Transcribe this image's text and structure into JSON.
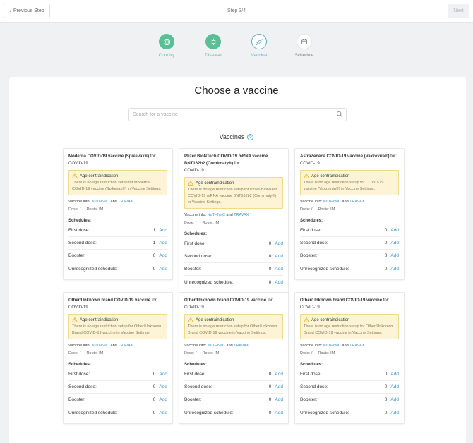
{
  "topbar": {
    "prev_label": "Previous Step",
    "step_label": "Step 3/4",
    "next_label": "Next"
  },
  "stepper": [
    {
      "label": "Country",
      "state": "done",
      "icon": "globe-icon"
    },
    {
      "label": "Disease",
      "state": "done",
      "icon": "virus-icon"
    },
    {
      "label": "Vaccine",
      "state": "active",
      "icon": "syringe-icon"
    },
    {
      "label": "Schedule",
      "state": "pending",
      "icon": "calendar-icon"
    }
  ],
  "main": {
    "title": "Choose a vaccine",
    "search_placeholder": "Search for a vaccine",
    "vaccines_label": "Vaccines",
    "vaccines_count": "6"
  },
  "colors": {
    "green": "#5bbf95",
    "blue": "#5ba9d6",
    "link": "#3a97d4",
    "warning_bg": "#fdf4d6"
  },
  "cards": [
    {
      "name": "Moderna COVID-19 vaccine (Spikevax®)",
      "for_label": "for:",
      "disease": "COVID-19",
      "warn_title": "Age contraindication",
      "warn_text": "There is no age restriction setup for Moderna COVID-19 vaccine (Spikevax®) in Vaccine Settings.",
      "info_label": "Vaccine info:",
      "link1": "NuTHNaC",
      "and": "and",
      "link2": "TRAVAX",
      "dose": "Dose: /",
      "route": "Route: IM",
      "schedules_label": "Schedules:",
      "schedules": [
        {
          "label": "First dose:",
          "count": "1",
          "action": "Add"
        },
        {
          "label": "Second dose:",
          "count": "1",
          "action": "Add"
        },
        {
          "label": "Booster:",
          "count": "0",
          "action": "Add"
        },
        {
          "label": "Unrecognized schedule:",
          "count": "0",
          "action": "Add"
        }
      ]
    },
    {
      "name": "Pfizer BioNTech COVID-19 mRNA vaccine BNT162b2 (Comirnaty®)",
      "for_label": "for:",
      "disease": "COVID-19",
      "warn_title": "Age contraindication",
      "warn_text": "There is no age restriction setup for Pfizer-BioNTech COVID-19 mRNA vaccine BNT162b2 (Comirnaty®) in Vaccine Settings.",
      "info_label": "Vaccine info:",
      "link1": "NuTHNaC",
      "and": "and",
      "link2": "TRAVAX",
      "dose": "Dose: /",
      "route": "Route: IM",
      "schedules_label": "Schedules:",
      "schedules": [
        {
          "label": "First dose:",
          "count": "0",
          "action": "Add"
        },
        {
          "label": "Second dose:",
          "count": "0",
          "action": "Add"
        },
        {
          "label": "Booster:",
          "count": "0",
          "action": "Add"
        },
        {
          "label": "Unrecognized schedule:",
          "count": "0",
          "action": "Add"
        }
      ]
    },
    {
      "name": "AstraZeneca COVID-19 vaccine (Vaxzevria®)",
      "for_label": "for:",
      "disease": "COVID-19",
      "warn_title": "Age contraindication",
      "warn_text": "There is no age restriction setup for COVID-19 vaccine (Vaxzevria®) in Vaccine Settings.",
      "info_label": "Vaccine info:",
      "link1": "NuTHNaC",
      "and": "and",
      "link2": "TRAVAX",
      "dose": "Dose: /",
      "route": "Route: IM",
      "schedules_label": "Schedules:",
      "schedules": [
        {
          "label": "First dose:",
          "count": "0",
          "action": "Add"
        },
        {
          "label": "Second dose:",
          "count": "0",
          "action": "Add"
        },
        {
          "label": "Booster:",
          "count": "0",
          "action": "Add"
        },
        {
          "label": "Unrecognized schedule:",
          "count": "0",
          "action": "Add"
        }
      ]
    },
    {
      "name": "Other/Unknown brand COVID-19 vaccine",
      "for_label": "for:",
      "disease": "COVID-19",
      "warn_title": "Age contraindication",
      "warn_text": "There is no age restriction setup for Other/Unknown Brand COVID-19 vaccine in Vaccine Settings.",
      "info_label": "Vaccine info:",
      "link1": "NuTHNaC",
      "and": "and",
      "link2": "TRAVAX",
      "dose": "Dose: /",
      "route": "Route: IM",
      "schedules_label": "Schedules:",
      "schedules": [
        {
          "label": "First dose:",
          "count": "0",
          "action": "Add"
        },
        {
          "label": "Second dose:",
          "count": "0",
          "action": "Add"
        },
        {
          "label": "Booster:",
          "count": "0",
          "action": "Add"
        },
        {
          "label": "Unrecognized schedule:",
          "count": "0",
          "action": "Add"
        }
      ]
    },
    {
      "name": "Other/Unknown brand COVID-19 vaccine",
      "for_label": "for:",
      "disease": "COVID-19",
      "warn_title": "Age contraindication",
      "warn_text": "There is no age restriction setup for Other/Unknown Brand COVID-19 vaccine in Vaccine Settings.",
      "info_label": "Vaccine info:",
      "link1": "NuTHNaC",
      "and": "and",
      "link2": "TRAVAX",
      "dose": "Dose: /",
      "route": "Route: IM",
      "schedules_label": "Schedules:",
      "schedules": [
        {
          "label": "First dose:",
          "count": "0",
          "action": "Add"
        },
        {
          "label": "Second dose:",
          "count": "0",
          "action": "Add"
        },
        {
          "label": "Booster:",
          "count": "0",
          "action": "Add"
        },
        {
          "label": "Unrecognized schedule:",
          "count": "0",
          "action": "Add"
        }
      ]
    },
    {
      "name": "Other/Unknown brand COVID-19 vaccine",
      "for_label": "for:",
      "disease": "COVID-19",
      "warn_title": "Age contraindication",
      "warn_text": "There is no age restriction setup for Other/Unknown Brand COVID-19 vaccine in Vaccine Settings.",
      "info_label": "Vaccine info:",
      "link1": "NuTHNaC",
      "and": "and",
      "link2": "TRAVAX",
      "dose": "Dose: /",
      "route": "Route: IM",
      "schedules_label": "Schedules:",
      "schedules": [
        {
          "label": "First dose:",
          "count": "0",
          "action": "Add"
        },
        {
          "label": "Second dose:",
          "count": "0",
          "action": "Add"
        },
        {
          "label": "Booster:",
          "count": "0",
          "action": "Add"
        },
        {
          "label": "Unrecognized schedule:",
          "count": "0",
          "action": "Add"
        }
      ]
    }
  ]
}
